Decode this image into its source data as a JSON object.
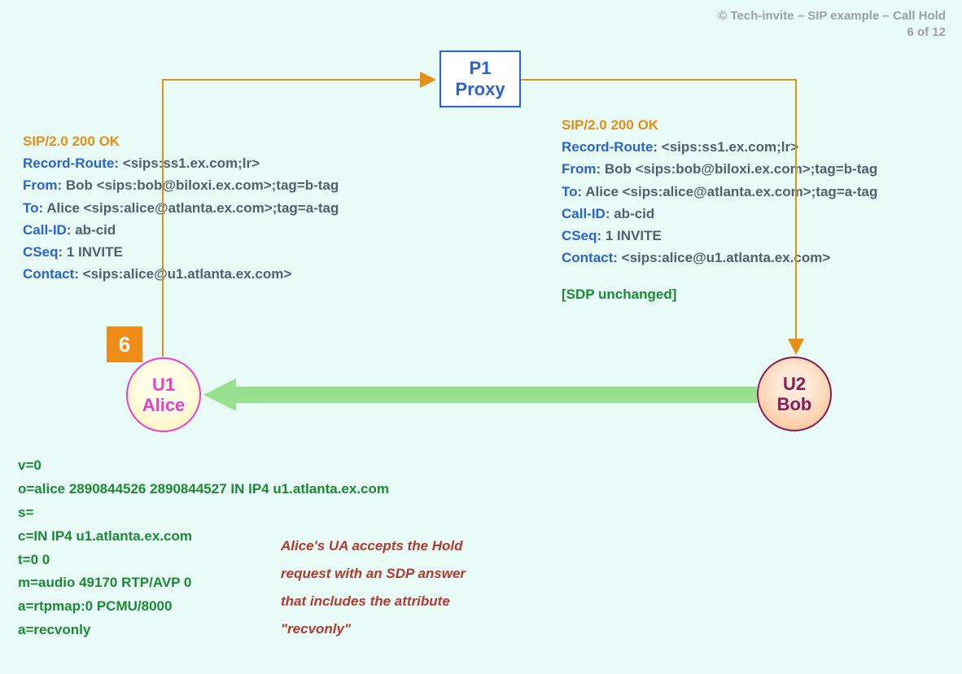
{
  "header": {
    "copyright": "© Tech-invite – SIP example – Call Hold",
    "page_counter": "6 of 12"
  },
  "nodes": {
    "proxy": {
      "line1": "P1",
      "line2": "Proxy"
    },
    "alice": {
      "line1": "U1",
      "line2": "Alice"
    },
    "bob": {
      "line1": "U2",
      "line2": "Bob"
    }
  },
  "step_badge": "6",
  "sip_left": {
    "status": "SIP/2.0 200 OK",
    "headers": [
      {
        "name": "Record-Route",
        "value": ": <sips:ss1.ex.com;lr>"
      },
      {
        "name": "From",
        "value": ": Bob <sips:bob@biloxi.ex.com>;tag=b-tag"
      },
      {
        "name": "To",
        "value": ": Alice <sips:alice@atlanta.ex.com>;tag=a-tag"
      },
      {
        "name": "Call-ID",
        "value": ": ab-cid"
      },
      {
        "name": "CSeq",
        "value": ": 1 INVITE"
      },
      {
        "name": "Contact",
        "value": ": <sips:alice@u1.atlanta.ex.com>"
      }
    ]
  },
  "sip_right": {
    "status": "SIP/2.0 200 OK",
    "headers": [
      {
        "name": "Record-Route",
        "value": ": <sips:ss1.ex.com;lr>"
      },
      {
        "name": "From",
        "value": ": Bob <sips:bob@biloxi.ex.com>;tag=b-tag"
      },
      {
        "name": "To",
        "value": ": Alice <sips:alice@atlanta.ex.com>;tag=a-tag"
      },
      {
        "name": "Call-ID",
        "value": ": ab-cid"
      },
      {
        "name": "CSeq",
        "value": ": 1 INVITE"
      },
      {
        "name": "Contact",
        "value": ": <sips:alice@u1.atlanta.ex.com>"
      }
    ],
    "sdp_note": "[SDP unchanged]"
  },
  "sdp": [
    "v=0",
    "o=alice  2890844526  2890844527  IN  IP4  u1.atlanta.ex.com",
    "s=",
    "c=IN  IP4  u1.atlanta.ex.com",
    "t=0  0",
    "m=audio  49170  RTP/AVP  0",
    "a=rtpmap:0  PCMU/8000",
    "a=recvonly"
  ],
  "explanation": "Alice's UA accepts the Hold request with an SDP answer that includes the attribute \"recvonly\"",
  "colors": {
    "orange": "#e88e17",
    "blue": "#2a63d6",
    "green": "#1a8a34",
    "brick": "#b33a2f",
    "arrow_green": "#97e08d"
  }
}
